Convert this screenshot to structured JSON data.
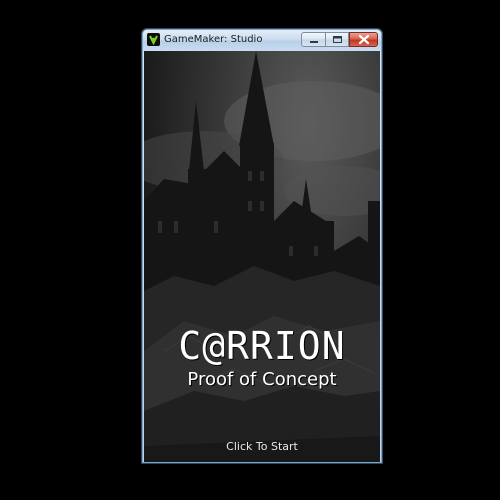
{
  "window": {
    "title": "GameMaker: Studio",
    "controls": [
      "minimize",
      "maximize",
      "close"
    ]
  },
  "game": {
    "title": "C@RRION",
    "subtitle": "Proof of Concept",
    "start_prompt": "Click To Start"
  },
  "icons": {
    "app": "gamemaker-icon",
    "minimize": "minimize-icon",
    "maximize": "maximize-icon",
    "close": "close-icon"
  },
  "colors": {
    "window_border": "#7ba6c9",
    "close_button": "#c2351f",
    "text": "#ffffff",
    "background": "#000000"
  }
}
